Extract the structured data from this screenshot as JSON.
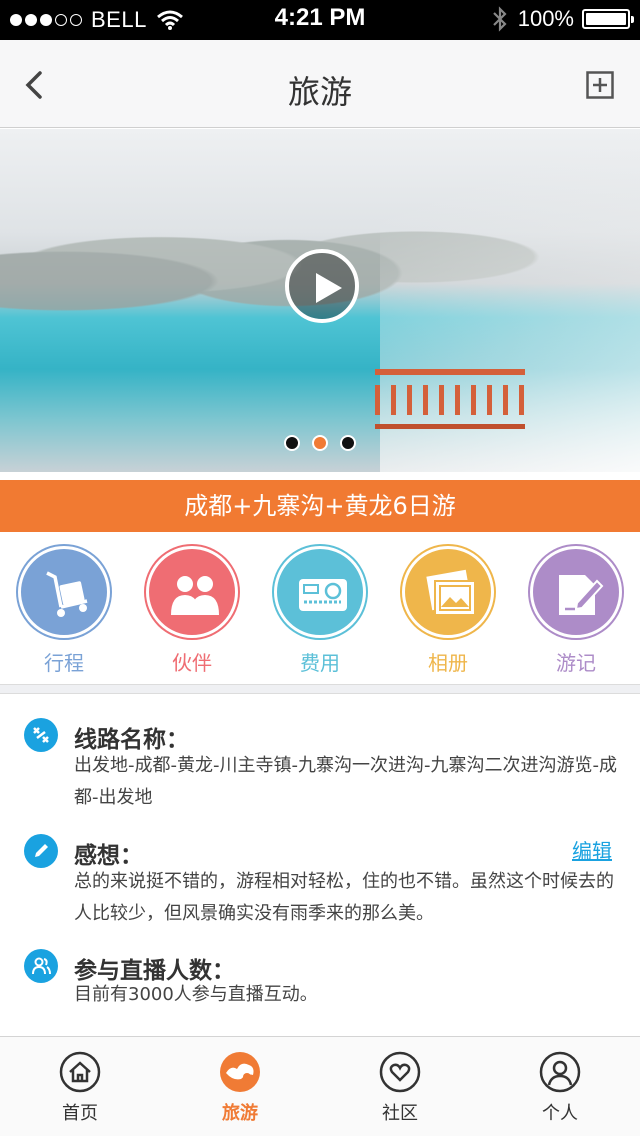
{
  "status_bar": {
    "carrier": "BELL",
    "time": "4:21 PM",
    "battery": "100%",
    "battery_level": 1.0
  },
  "nav": {
    "title": "旅游",
    "back_icon": "chevron-left-icon",
    "add_icon": "plus-square-icon"
  },
  "hero": {
    "pages": 3,
    "active_page": 1
  },
  "trip": {
    "title": "成都+九寨沟+黄龙6日游"
  },
  "categories": [
    {
      "label": "行程",
      "color": "#7aa2d6",
      "icon": "luggage-cart-icon"
    },
    {
      "label": "伙伴",
      "color": "#ef6d73",
      "icon": "partners-icon"
    },
    {
      "label": "费用",
      "color": "#5cc0d8",
      "icon": "card-money-icon"
    },
    {
      "label": "相册",
      "color": "#efb64b",
      "icon": "photo-album-icon"
    },
    {
      "label": "游记",
      "color": "#ad8cc8",
      "icon": "note-pen-icon"
    }
  ],
  "sections": {
    "route": {
      "heading": "线路名称：",
      "body": "出发地-成都-黄龙-川主寺镇-九寨沟一次进沟-九寨沟二次进沟游览-成都-出发地"
    },
    "thoughts": {
      "heading": "感想：",
      "action": "编辑",
      "body": "总的来说挺不错的，游程相对轻松，住的也不错。虽然这个时候去的人比较少，但风景确实没有雨季来的那么美。"
    },
    "viewers": {
      "heading": "参与直播人数：",
      "body": "目前有3000人参与直播互动。"
    }
  },
  "tabs": [
    {
      "label": "首页",
      "icon": "home-icon"
    },
    {
      "label": "旅游",
      "icon": "travel-icon"
    },
    {
      "label": "社区",
      "icon": "heart-icon"
    },
    {
      "label": "个人",
      "icon": "user-icon"
    }
  ],
  "colors": {
    "accent": "#f17a32",
    "info_icon": "#1aa2e0"
  }
}
